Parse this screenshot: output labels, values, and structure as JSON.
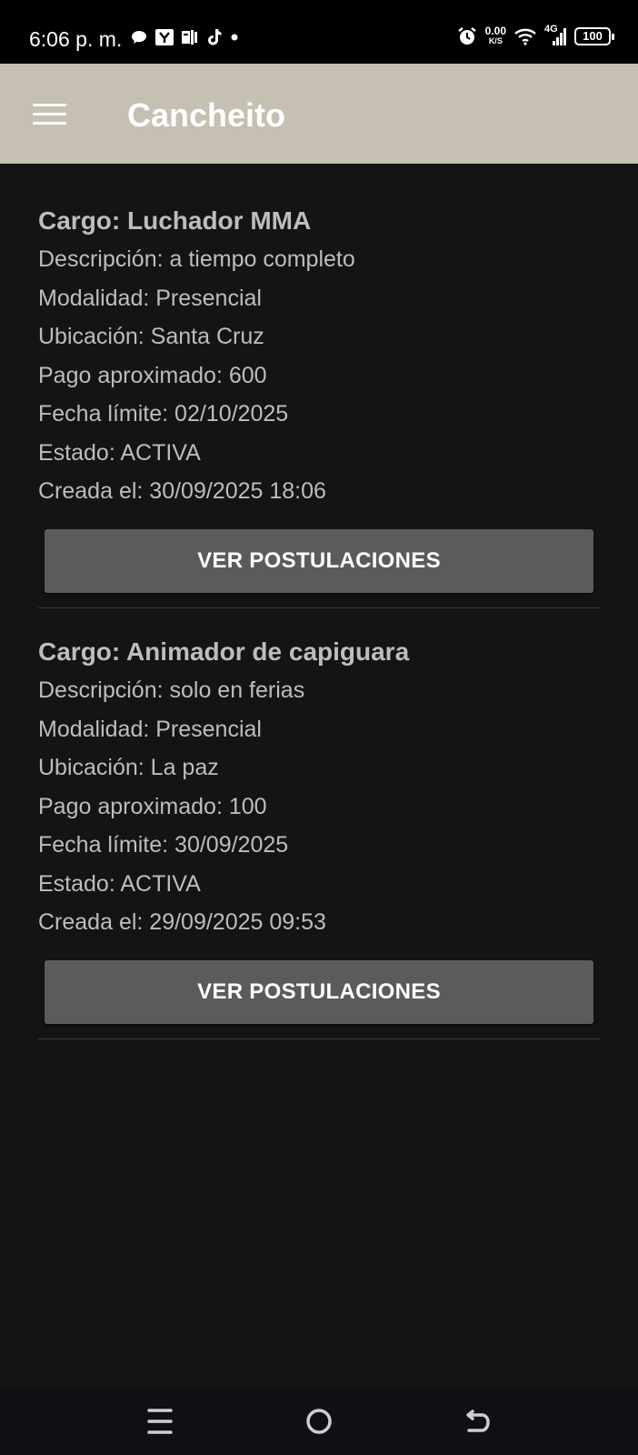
{
  "status_bar": {
    "time": "6:06 p. m.",
    "net_speed_value": "0.00",
    "net_speed_unit": "K/S",
    "network": "4G",
    "battery": "100"
  },
  "app_bar": {
    "title": "Cancheito",
    "menu_icon": "hamburger-icon"
  },
  "offers": [
    {
      "title": "Cargo: Luchador MMA",
      "description": "Descripción: a tiempo completo",
      "modality": "Modalidad: Presencial",
      "location": "Ubicación: Santa Cruz",
      "payment": "Pago aproximado: 600",
      "deadline": "Fecha límite: 02/10/2025",
      "status": "Estado: ACTIVA",
      "created": "Creada el: 30/09/2025 18:06",
      "button_label": "VER POSTULACIONES"
    },
    {
      "title": "Cargo: Animador de capiguara",
      "description": "Descripción: solo en ferias",
      "modality": "Modalidad: Presencial",
      "location": "Ubicación: La paz",
      "payment": "Pago aproximado: 100",
      "deadline": "Fecha límite: 30/09/2025",
      "status": "Estado: ACTIVA",
      "created": "Creada el: 29/09/2025 09:53",
      "button_label": "VER POSTULACIONES"
    }
  ],
  "nav_bar": {
    "icons": [
      "recents-icon",
      "home-icon",
      "back-icon"
    ]
  },
  "colors": {
    "app_bar": "#c5c0b2",
    "background": "#141414",
    "button": "#5b5b5d"
  }
}
